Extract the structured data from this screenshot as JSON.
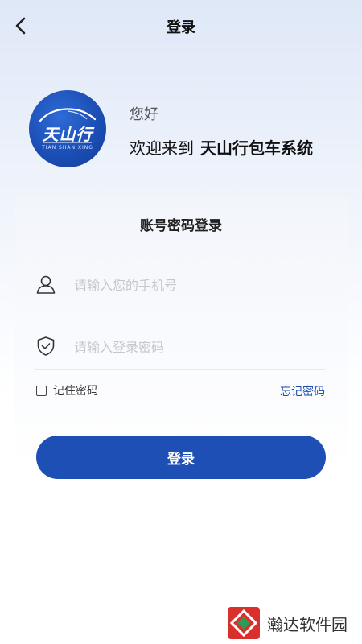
{
  "header": {
    "title": "登录"
  },
  "brand": {
    "logo_main": "天山行",
    "logo_sub": "TIAN SHAN XING",
    "greeting": "您好",
    "welcome_prefix": "欢迎来到",
    "app_name": "天山行包车系统"
  },
  "form": {
    "title": "账号密码登录",
    "phone_placeholder": "请输入您的手机号",
    "password_placeholder": "请输入登录密码",
    "remember_label": "记住密码",
    "forgot_label": "忘记密码",
    "login_label": "登录"
  },
  "watermark": {
    "text": "瀚达软件园"
  },
  "colors": {
    "primary": "#1d4fb4",
    "link": "#1a4cb2",
    "placeholder": "#c4c7ce"
  }
}
